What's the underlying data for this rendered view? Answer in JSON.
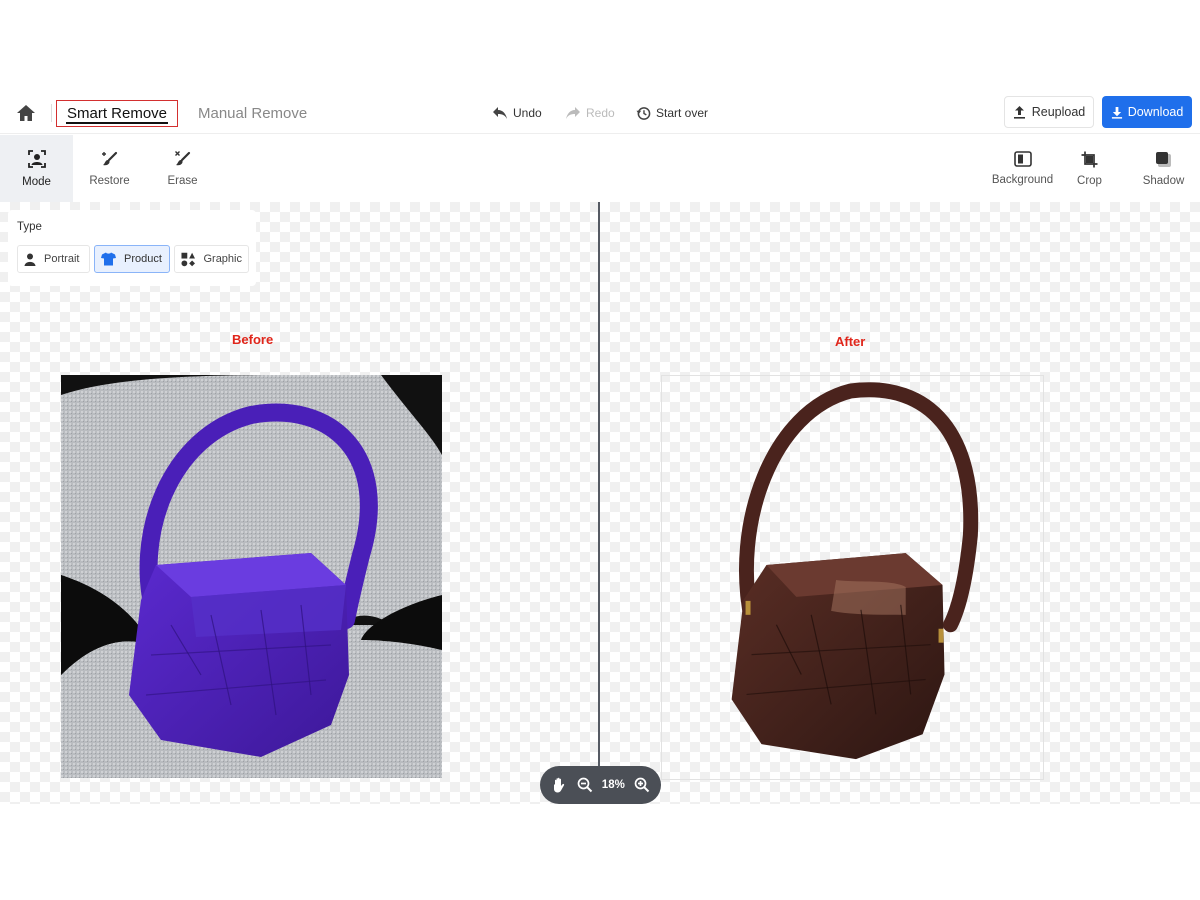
{
  "header": {
    "tabs": {
      "smart": "Smart Remove",
      "manual": "Manual Remove"
    },
    "undo": "Undo",
    "redo": "Redo",
    "start_over": "Start over",
    "reupload": "Reupload",
    "download": "Download"
  },
  "toolbar": {
    "left": {
      "mode": "Mode",
      "restore": "Restore",
      "erase": "Erase"
    },
    "right": {
      "background": "Background",
      "crop": "Crop",
      "shadow": "Shadow"
    },
    "active_tool": "Mode"
  },
  "type_panel": {
    "label": "Type",
    "options": {
      "portrait": "Portrait",
      "product": "Product",
      "graphic": "Graphic"
    },
    "selected": "Product"
  },
  "canvas": {
    "before_label": "Before",
    "after_label": "After"
  },
  "zoom": {
    "level": "18%"
  },
  "colors": {
    "accent": "#1f6feb",
    "label_red": "#e0261b",
    "bag_before": "#4b1fb0",
    "bag_after": "#3e1f19",
    "zoom_bar": "#4b4f56"
  }
}
